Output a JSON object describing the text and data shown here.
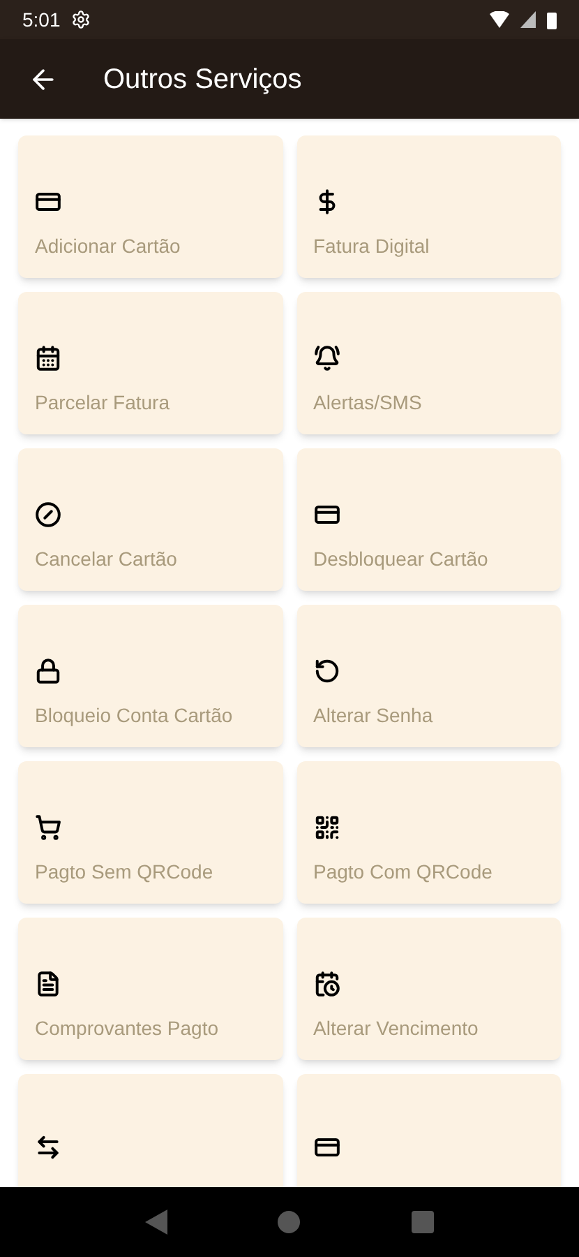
{
  "status_bar": {
    "time": "5:01"
  },
  "app_bar": {
    "title": "Outros Serviços"
  },
  "services": [
    {
      "kind": "card-add",
      "label": "Adicionar Cartão"
    },
    {
      "kind": "dollar",
      "label": "Fatura Digital"
    },
    {
      "kind": "calendar",
      "label": "Parcelar Fatura"
    },
    {
      "kind": "bell",
      "label": "Alertas/SMS"
    },
    {
      "kind": "card-off",
      "label": "Cancelar Cartão"
    },
    {
      "kind": "card-unlock",
      "label": "Desbloquear Cartão"
    },
    {
      "kind": "card-lock",
      "label": "Bloqueio Conta Cartão"
    },
    {
      "kind": "lock-reset",
      "label": "Alterar Senha"
    },
    {
      "kind": "cart",
      "label": "Pagto Sem QRCode"
    },
    {
      "kind": "qr",
      "label": "Pagto Com QRCode"
    },
    {
      "kind": "list",
      "label": "Comprovantes Pagto"
    },
    {
      "kind": "calendar-refresh",
      "label": "Alterar Vencimento"
    },
    {
      "kind": "transfer"
    },
    {
      "kind": "card"
    }
  ]
}
